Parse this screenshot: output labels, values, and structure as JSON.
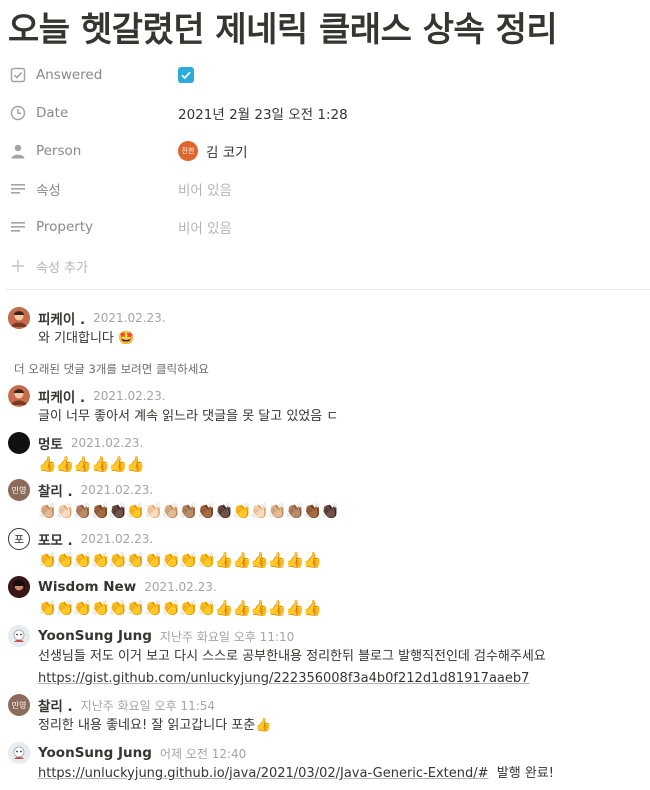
{
  "page": {
    "title": "오늘 헷갈렸던 제네릭 클래스 상속 정리"
  },
  "properties": [
    {
      "name": "Answered",
      "icon": "checkbox-icon",
      "value": "",
      "type": "checkbox",
      "checked": true
    },
    {
      "name": "Date",
      "icon": "clock-icon",
      "value": "2021년 2월 23일 오전 1:28",
      "type": "text"
    },
    {
      "name": "Person",
      "icon": "person-icon",
      "value": "김 코기",
      "avatar_text": "진한",
      "type": "person"
    },
    {
      "name": "속성",
      "icon": "text-lines-icon",
      "value": "비어 있음",
      "type": "empty"
    },
    {
      "name": "Property",
      "icon": "text-lines-icon",
      "value": "비어 있음",
      "type": "empty"
    }
  ],
  "add_property_label": "속성 추가",
  "show_more_label": "더 오래된 댓글 3개를 보려면 클릭하세요",
  "comments": [
    {
      "author": "피케이 .",
      "time": "2021.02.23.",
      "body": "와 기대합니다 🤩",
      "avatar_color": "#b5523b",
      "avatar_text": ""
    },
    {
      "author": "피케이 .",
      "time": "2021.02.23.",
      "body": "글이 너무 좋아서 계속 읽느라 댓글을 못 달고 있었음 ㄷ",
      "avatar_color": "#b5523b",
      "avatar_text": ""
    },
    {
      "author": "멍토",
      "time": "2021.02.23.",
      "body": "👍👍👍👍👍👍",
      "avatar_color": "#111111",
      "avatar_text": ""
    },
    {
      "author": "찰리 .",
      "time": "2021.02.23.",
      "body": "👏🏼👏🏻👏🏽👏🏾👏🏿👏👏🏻👏🏼👏🏽👏🏾👏🏿👏👏🏻👏🏼👏🏽👏🏾👏🏿",
      "avatar_color": "#8c6a5c",
      "avatar_text": "민영"
    },
    {
      "author": "포모 .",
      "time": "2021.02.23.",
      "body": "👏👏👏👏👏👏👏👏👏👏👍👍👍👍👍👍",
      "avatar_color": "#ffffff",
      "avatar_text": "포"
    },
    {
      "author": "Wisdom New",
      "time": "2021.02.23.",
      "body": "👏👏👏👏👏👏👏👏👏👏👍👍👍👍👍👍",
      "avatar_color": "#5a2323",
      "avatar_text": ""
    },
    {
      "author": "YoonSung Jung",
      "time": "지난주 화요일 오후 11:10",
      "body": "선생님들 저도 이거 보고 다시 스스로 공부한내용 정리한뒤 블로그 발행직전인데 검수해주세요",
      "link": "https://gist.github.com/unluckyjung/222356008f3a4b0f212d1d81917aaeb7",
      "avatar_color": "#dfe6ea",
      "avatar_text": ""
    },
    {
      "author": "찰리 .",
      "time": "지난주 화요일 오후 11:54",
      "body": "정리한 내용 좋네요!  잘 읽고갑니다 포춘👍",
      "avatar_color": "#8c6a5c",
      "avatar_text": "민영"
    },
    {
      "author": "YoonSung Jung",
      "time": "어제 오전 12:40",
      "link": "https://unluckyjung.github.io/java/2021/03/02/Java-Generic-Extend/#",
      "link_suffix": "  발행 완료!",
      "avatar_color": "#dfe6ea",
      "avatar_text": ""
    }
  ]
}
